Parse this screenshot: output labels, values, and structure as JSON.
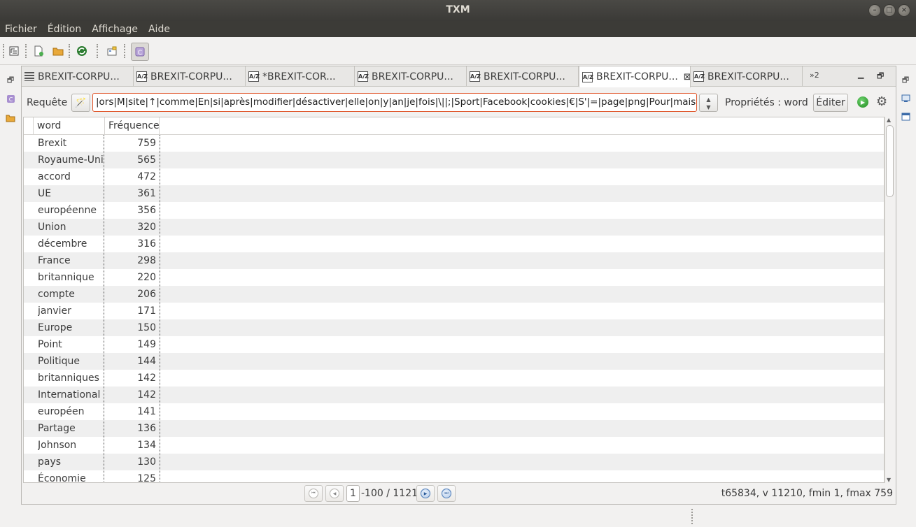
{
  "window": {
    "title": "TXM"
  },
  "menu": [
    "Fichier",
    "Édition",
    "Affichage",
    "Aide"
  ],
  "tabs": [
    {
      "label": "BREXIT-CORPU...",
      "icon": "table-icon"
    },
    {
      "label": "BREXIT-CORPU...",
      "icon": "lexicon-icon"
    },
    {
      "label": "*BREXIT-COR...",
      "icon": "lexicon-icon"
    },
    {
      "label": "BREXIT-CORPU...",
      "icon": "lexicon-icon"
    },
    {
      "label": "BREXIT-CORPU...",
      "icon": "lexicon-icon"
    },
    {
      "label": "BREXIT-CORPU...",
      "icon": "lexicon-icon",
      "active": true
    },
    {
      "label": "BREXIT-CORPU...",
      "icon": "lexicon-icon"
    }
  ],
  "tabs_overflow": "»2",
  "query": {
    "label": "Requête",
    "value": "|ors|M|site|↑|comme|En|si|après|modifier|désactiver|elle|on|y|an|je|fois|\\||;|Sport|Facebook|cookies|€|S'|=|page|png|Pour|mais\"]",
    "properties_label": "Propriétés : word",
    "edit_label": "Éditer"
  },
  "table": {
    "columns": [
      "word",
      "Fréquence"
    ],
    "rows": [
      [
        "Brexit",
        "759"
      ],
      [
        "Royaume-Uni",
        "565"
      ],
      [
        "accord",
        "472"
      ],
      [
        "UE",
        "361"
      ],
      [
        "européenne",
        "356"
      ],
      [
        "Union",
        "320"
      ],
      [
        "décembre",
        "316"
      ],
      [
        "France",
        "298"
      ],
      [
        "britannique",
        "220"
      ],
      [
        "compte",
        "206"
      ],
      [
        "janvier",
        "171"
      ],
      [
        "Europe",
        "150"
      ],
      [
        "Point",
        "149"
      ],
      [
        "Politique",
        "144"
      ],
      [
        "britanniques",
        "142"
      ],
      [
        "International",
        "142"
      ],
      [
        "européen",
        "141"
      ],
      [
        "Partage",
        "136"
      ],
      [
        "Johnson",
        "134"
      ],
      [
        "pays",
        "130"
      ],
      [
        "Économie",
        "125"
      ]
    ]
  },
  "pager": {
    "current": "1",
    "range": "-100 / 11210",
    "stats": "t65834, v 11210, fmin 1, fmax 759"
  }
}
